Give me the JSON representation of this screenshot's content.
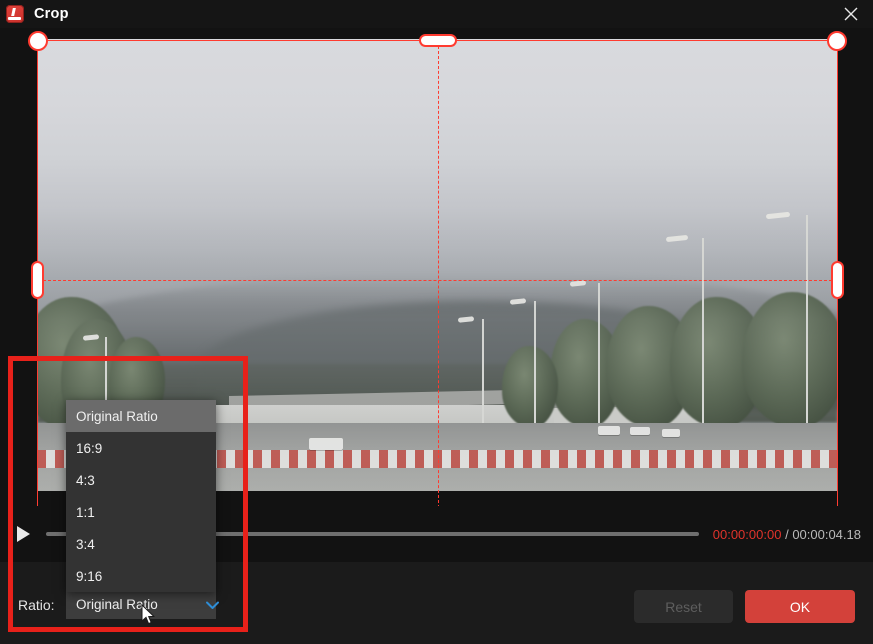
{
  "window": {
    "title": "Crop",
    "app_icon": "app-logo-icon",
    "close_icon": "close-icon"
  },
  "preview": {
    "crop_overlay": {
      "frame_color": "#ff3b30",
      "handle_fill": "#ffffff",
      "guides": "crosshair-dashed"
    },
    "scene_description": "foggy mountain road with trees, wall, street lamps and parked cars"
  },
  "transport": {
    "play_icon": "play-icon",
    "current_time": "00:00:00:00",
    "separator": "/",
    "total_time": "00:00:04.18",
    "progress_percent": 0,
    "current_time_color": "#e0332b"
  },
  "bottom": {
    "ratio_label": "Ratio:",
    "ratio_value": "Original Ratio",
    "chevron_icon": "chevron-down-icon",
    "chevron_color": "#2f8fd8",
    "reset_label": "Reset",
    "reset_enabled": false,
    "ok_label": "OK",
    "ok_color": "#d3413a"
  },
  "dropdown": {
    "open": true,
    "selected": "Original Ratio",
    "options": [
      {
        "label": "Original Ratio",
        "selected": true
      },
      {
        "label": "16:9",
        "selected": false
      },
      {
        "label": "4:3",
        "selected": false
      },
      {
        "label": "1:1",
        "selected": false
      },
      {
        "label": "3:4",
        "selected": false
      },
      {
        "label": "9:16",
        "selected": false
      }
    ]
  },
  "annotation": {
    "shape": "rectangle",
    "color": "#e8211a"
  },
  "cursor": {
    "icon": "mouse-pointer-icon"
  }
}
